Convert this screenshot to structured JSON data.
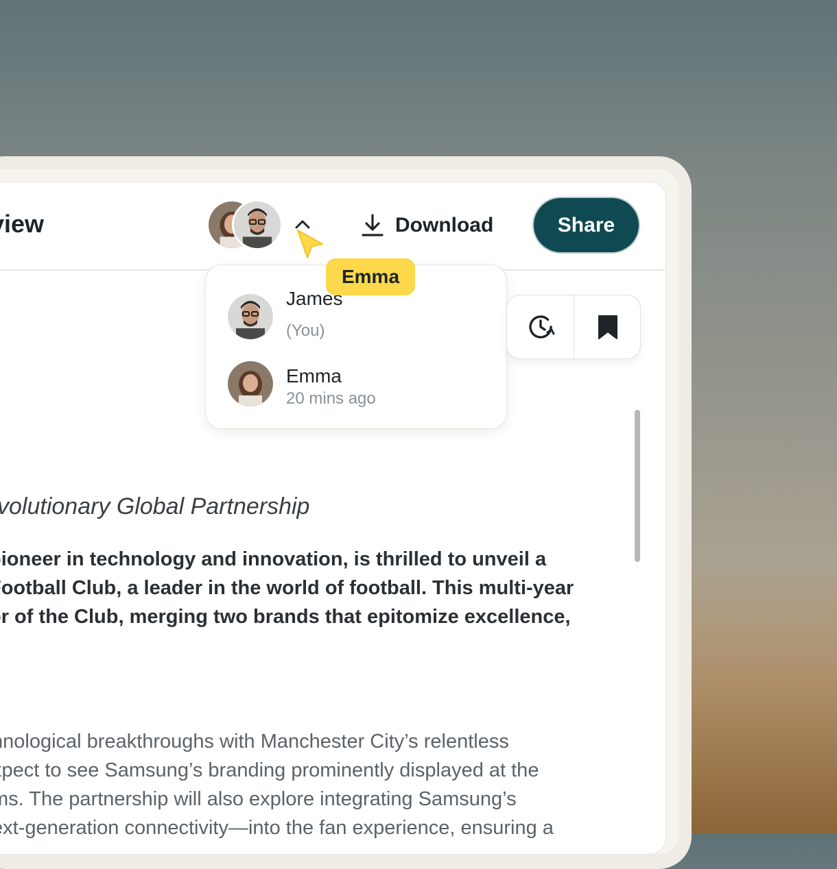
{
  "header": {
    "title": "view",
    "download_label": "Download",
    "share_label": "Share"
  },
  "collaborators": {
    "tooltip": "Emma",
    "list": [
      {
        "name": "James",
        "status": "(You)"
      },
      {
        "name": "Emma",
        "status": "20 mins ago"
      }
    ]
  },
  "toolbar": {
    "history_icon": "history-clock-icon",
    "bookmark_icon": "bookmark-icon"
  },
  "document": {
    "subheading": "volutionary Global Partnership",
    "lead": [
      "pioneer in technology and innovation, is thrilled to unveil a",
      "Football Club, a leader in the world of football. This multi-year",
      "or of the Club, merging two brands that epitomize excellence,"
    ],
    "body": [
      "nnological breakthroughs with Manchester City’s relentless",
      "xpect to see Samsung’s branding prominently displayed at the",
      "ms. The partnership will also explore integrating Samsung’s",
      "ext-generation connectivity—into the fan experience, ensuring a"
    ]
  },
  "colors": {
    "share_bg": "#0f4a52",
    "tooltip_bg": "#fcd84a"
  }
}
